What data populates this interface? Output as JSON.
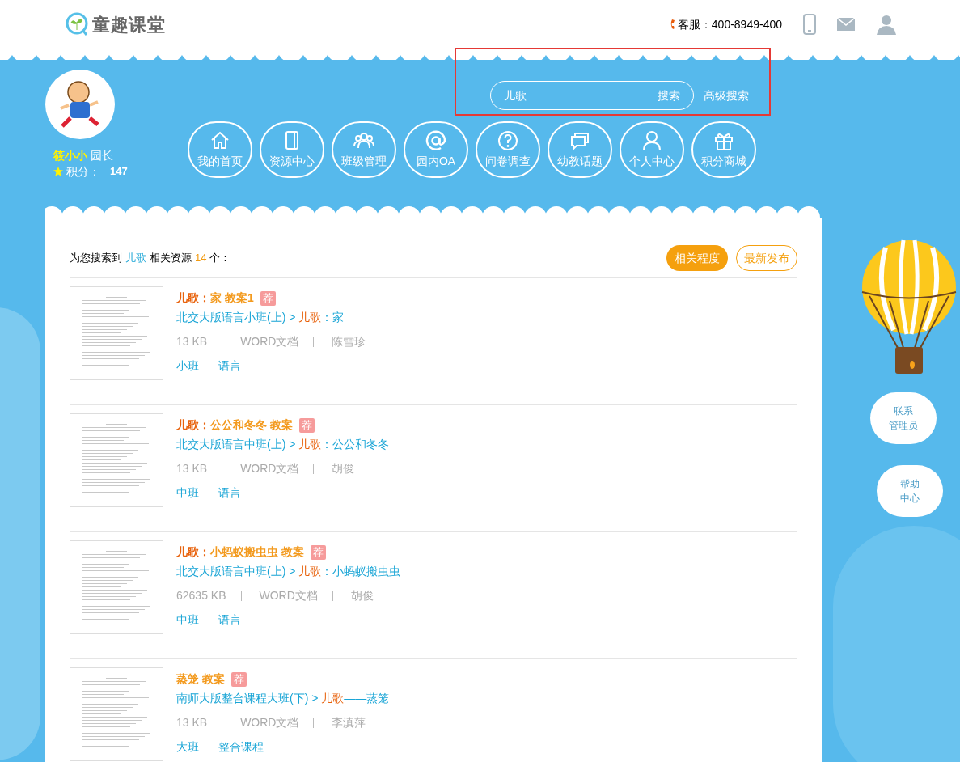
{
  "header": {
    "logo_text": "童趣课堂",
    "service_label": "客服：",
    "service_phone": "400-8949-400"
  },
  "search": {
    "value": "儿歌",
    "button": "搜索",
    "advanced": "高级搜索",
    "highlighted": true
  },
  "profile": {
    "name": "筱小小",
    "role": "园长",
    "points_label": "积分：",
    "points": "147"
  },
  "nav": [
    {
      "kind": "home",
      "label": "我的首页"
    },
    {
      "kind": "book",
      "label": "资源中心"
    },
    {
      "kind": "group",
      "label": "班级管理"
    },
    {
      "kind": "at",
      "label": "园内OA"
    },
    {
      "kind": "question",
      "label": "问卷调查"
    },
    {
      "kind": "chat",
      "label": "幼教话题"
    },
    {
      "kind": "person",
      "label": "个人中心"
    },
    {
      "kind": "gift",
      "label": "积分商城"
    }
  ],
  "results": {
    "summary": {
      "prefix": "为您搜索到",
      "keyword": "儿歌",
      "middle": "相关资源",
      "count": "14",
      "suffix": "个："
    },
    "sort": [
      {
        "label": "相关程度",
        "selected": true
      },
      {
        "label": "最新发布",
        "selected": false
      }
    ],
    "items": [
      {
        "title": [
          {
            "text": "儿歌：",
            "highlight": true
          },
          {
            "text": "家 教案1",
            "highlight": false
          }
        ],
        "badge": "荐",
        "path": [
          {
            "text": "北交大版语言小班(上) > ",
            "highlight": false
          },
          {
            "text": "儿歌",
            "highlight": true
          },
          {
            "text": "：家",
            "highlight": false
          }
        ],
        "size": "13 KB",
        "type": "WORD文档",
        "author": "陈雪珍",
        "tags": [
          "小班",
          "语言"
        ]
      },
      {
        "title": [
          {
            "text": "儿歌：",
            "highlight": true
          },
          {
            "text": "公公和冬冬 教案",
            "highlight": false
          }
        ],
        "badge": "荐",
        "path": [
          {
            "text": "北交大版语言中班(上) > ",
            "highlight": false
          },
          {
            "text": "儿歌",
            "highlight": true
          },
          {
            "text": "：公公和冬冬",
            "highlight": false
          }
        ],
        "size": "13 KB",
        "type": "WORD文档",
        "author": "胡俊",
        "tags": [
          "中班",
          "语言"
        ]
      },
      {
        "title": [
          {
            "text": "儿歌：",
            "highlight": true
          },
          {
            "text": "小蚂蚁搬虫虫 教案",
            "highlight": false
          }
        ],
        "badge": "荐",
        "path": [
          {
            "text": "北交大版语言中班(上) > ",
            "highlight": false
          },
          {
            "text": "儿歌",
            "highlight": true
          },
          {
            "text": "：小蚂蚁搬虫虫",
            "highlight": false
          }
        ],
        "size": "62635 KB",
        "type": "WORD文档",
        "author": "胡俊",
        "tags": [
          "中班",
          "语言"
        ]
      },
      {
        "title": [
          {
            "text": "蒸笼 教案",
            "highlight": false
          }
        ],
        "badge": "荐",
        "path": [
          {
            "text": "南师大版整合课程大班(下) > ",
            "highlight": false
          },
          {
            "text": "儿歌",
            "highlight": true
          },
          {
            "text": "——蒸笼",
            "highlight": false
          }
        ],
        "size": "13 KB",
        "type": "WORD文档",
        "author": "李滇萍",
        "tags": [
          "大班",
          "整合课程"
        ]
      }
    ]
  },
  "side": [
    {
      "lines": [
        "联系",
        "管理员"
      ]
    },
    {
      "lines": [
        "帮助",
        "中心"
      ]
    }
  ]
}
